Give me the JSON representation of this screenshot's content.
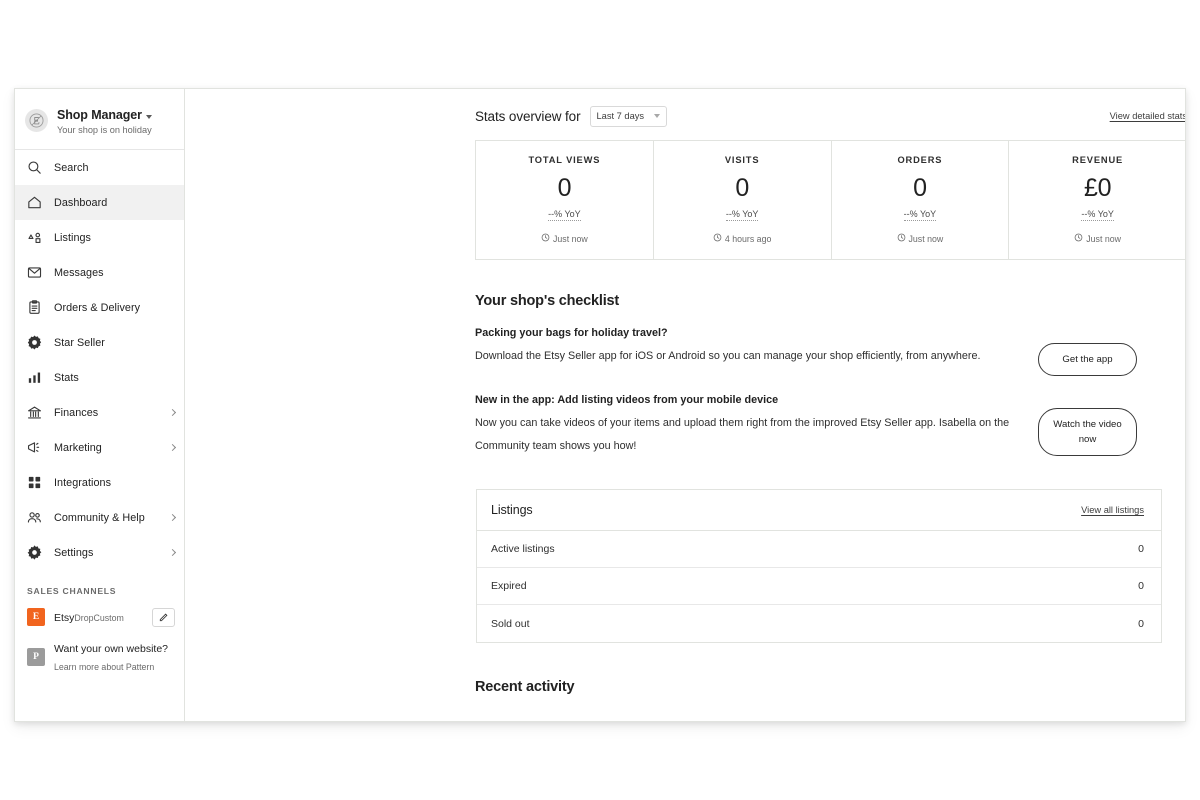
{
  "sidebar": {
    "shop": {
      "name": "Shop Manager",
      "status": "Your shop is on holiday",
      "avatar_icon": "etsy-avatar-icon",
      "caret_icon": "caret-down-icon"
    },
    "nav": [
      {
        "label": "Search",
        "icon": "search-icon",
        "active": false,
        "chevron": false
      },
      {
        "label": "Dashboard",
        "icon": "home-icon",
        "active": true,
        "chevron": false
      },
      {
        "label": "Listings",
        "icon": "listings-icon",
        "active": false,
        "chevron": false
      },
      {
        "label": "Messages",
        "icon": "message-icon",
        "active": false,
        "chevron": false
      },
      {
        "label": "Orders & Delivery",
        "icon": "clipboard-icon",
        "active": false,
        "chevron": false
      },
      {
        "label": "Star Seller",
        "icon": "star-badge-icon",
        "active": false,
        "chevron": false
      },
      {
        "label": "Stats",
        "icon": "bar-chart-icon",
        "active": false,
        "chevron": false
      },
      {
        "label": "Finances",
        "icon": "bank-icon",
        "active": false,
        "chevron": true
      },
      {
        "label": "Marketing",
        "icon": "megaphone-icon",
        "active": false,
        "chevron": true
      },
      {
        "label": "Integrations",
        "icon": "grid-icon",
        "active": false,
        "chevron": false
      },
      {
        "label": "Community & Help",
        "icon": "people-icon",
        "active": false,
        "chevron": true
      },
      {
        "label": "Settings",
        "icon": "gear-icon",
        "active": false,
        "chevron": true
      }
    ],
    "sales_channels_label": "SALES CHANNELS",
    "channels": [
      {
        "badge": "E",
        "badge_color": "#F1641E",
        "title": "Etsy",
        "subtitle": "DropCustom",
        "has_edit": true,
        "edit_icon": "pencil-icon"
      },
      {
        "badge": "P",
        "badge_color": "#9B9B9B",
        "title": "Want your own website?",
        "subtitle": "Learn more about Pattern",
        "has_edit": false,
        "edit_icon": ""
      }
    ]
  },
  "stats_overview": {
    "title": "Stats overview for",
    "range_value": "Last 7 days",
    "range_caret_icon": "caret-down-icon",
    "detail_link": "View detailed stats",
    "cards": [
      {
        "label": "TOTAL VIEWS",
        "value": "0",
        "yoy": "--% YoY",
        "time": "Just now",
        "clock_icon": "clock-icon"
      },
      {
        "label": "VISITS",
        "value": "0",
        "yoy": "--% YoY",
        "time": "4 hours ago",
        "clock_icon": "clock-icon"
      },
      {
        "label": "ORDERS",
        "value": "0",
        "yoy": "--% YoY",
        "time": "Just now",
        "clock_icon": "clock-icon"
      },
      {
        "label": "REVENUE",
        "value": "£0",
        "yoy": "--% YoY",
        "time": "Just now",
        "clock_icon": "clock-icon"
      }
    ]
  },
  "checklist": {
    "title": "Your shop's checklist",
    "items": [
      {
        "heading": "Packing your bags for holiday travel?",
        "body": "Download the Etsy Seller app for iOS or Android so you can manage your shop efficiently, from anywhere.",
        "button": "Get the app"
      },
      {
        "heading": "New in the app: Add listing videos from your mobile device",
        "body": "Now you can take videos of your items and upload them right from the improved Etsy Seller app. Isabella on the Community team shows you how!",
        "button": "Watch the video now"
      }
    ]
  },
  "listings_panel": {
    "title": "Listings",
    "link": "View all listings",
    "rows": [
      {
        "label": "Active listings",
        "value": "0"
      },
      {
        "label": "Expired",
        "value": "0"
      },
      {
        "label": "Sold out",
        "value": "0"
      }
    ]
  },
  "recent_activity": {
    "title": "Recent activity"
  }
}
